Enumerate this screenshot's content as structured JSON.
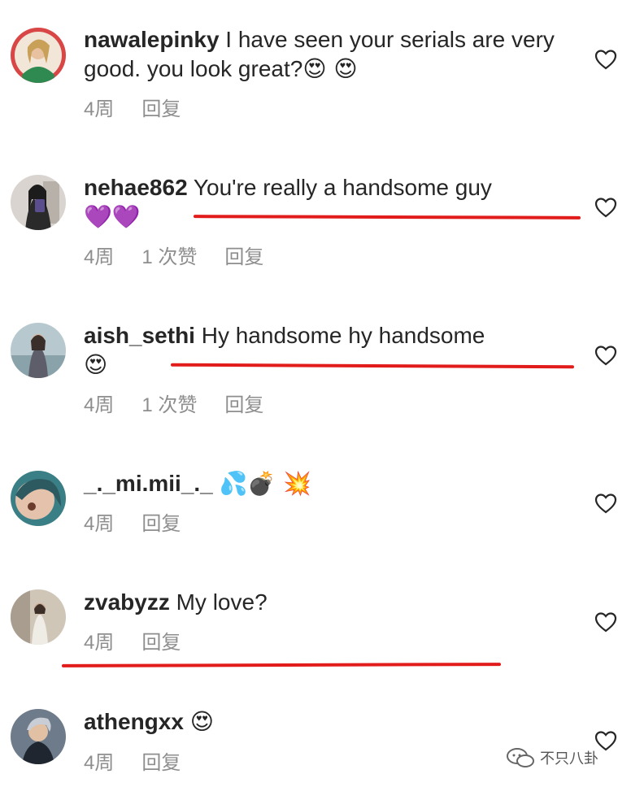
{
  "time_label": "4周",
  "reply_label": "回复",
  "comments": [
    {
      "username": "nawalepinky",
      "text": "I have seen your serials are very good.  you look great?",
      "emoji": "😍 😍",
      "likes": ""
    },
    {
      "username": "nehae862",
      "text": "You're really a handsome guy",
      "emoji": "💜💜",
      "likes": "1 次赞"
    },
    {
      "username": "aish_sethi",
      "text": "Hy handsome hy handsome",
      "emoji": "😍",
      "likes": "1 次赞"
    },
    {
      "username": "_._mi.mii_._",
      "text": "",
      "emoji": "💦💣 💥",
      "likes": ""
    },
    {
      "username": "zvabyzz",
      "text": "My love?",
      "emoji": "",
      "likes": ""
    },
    {
      "username": "athengxx",
      "text": "",
      "emoji": "😍",
      "likes": ""
    }
  ],
  "watermark": "不只八卦",
  "colors": {
    "underline": "#e21b1b",
    "meta": "#8e8e8e",
    "text": "#262626"
  }
}
